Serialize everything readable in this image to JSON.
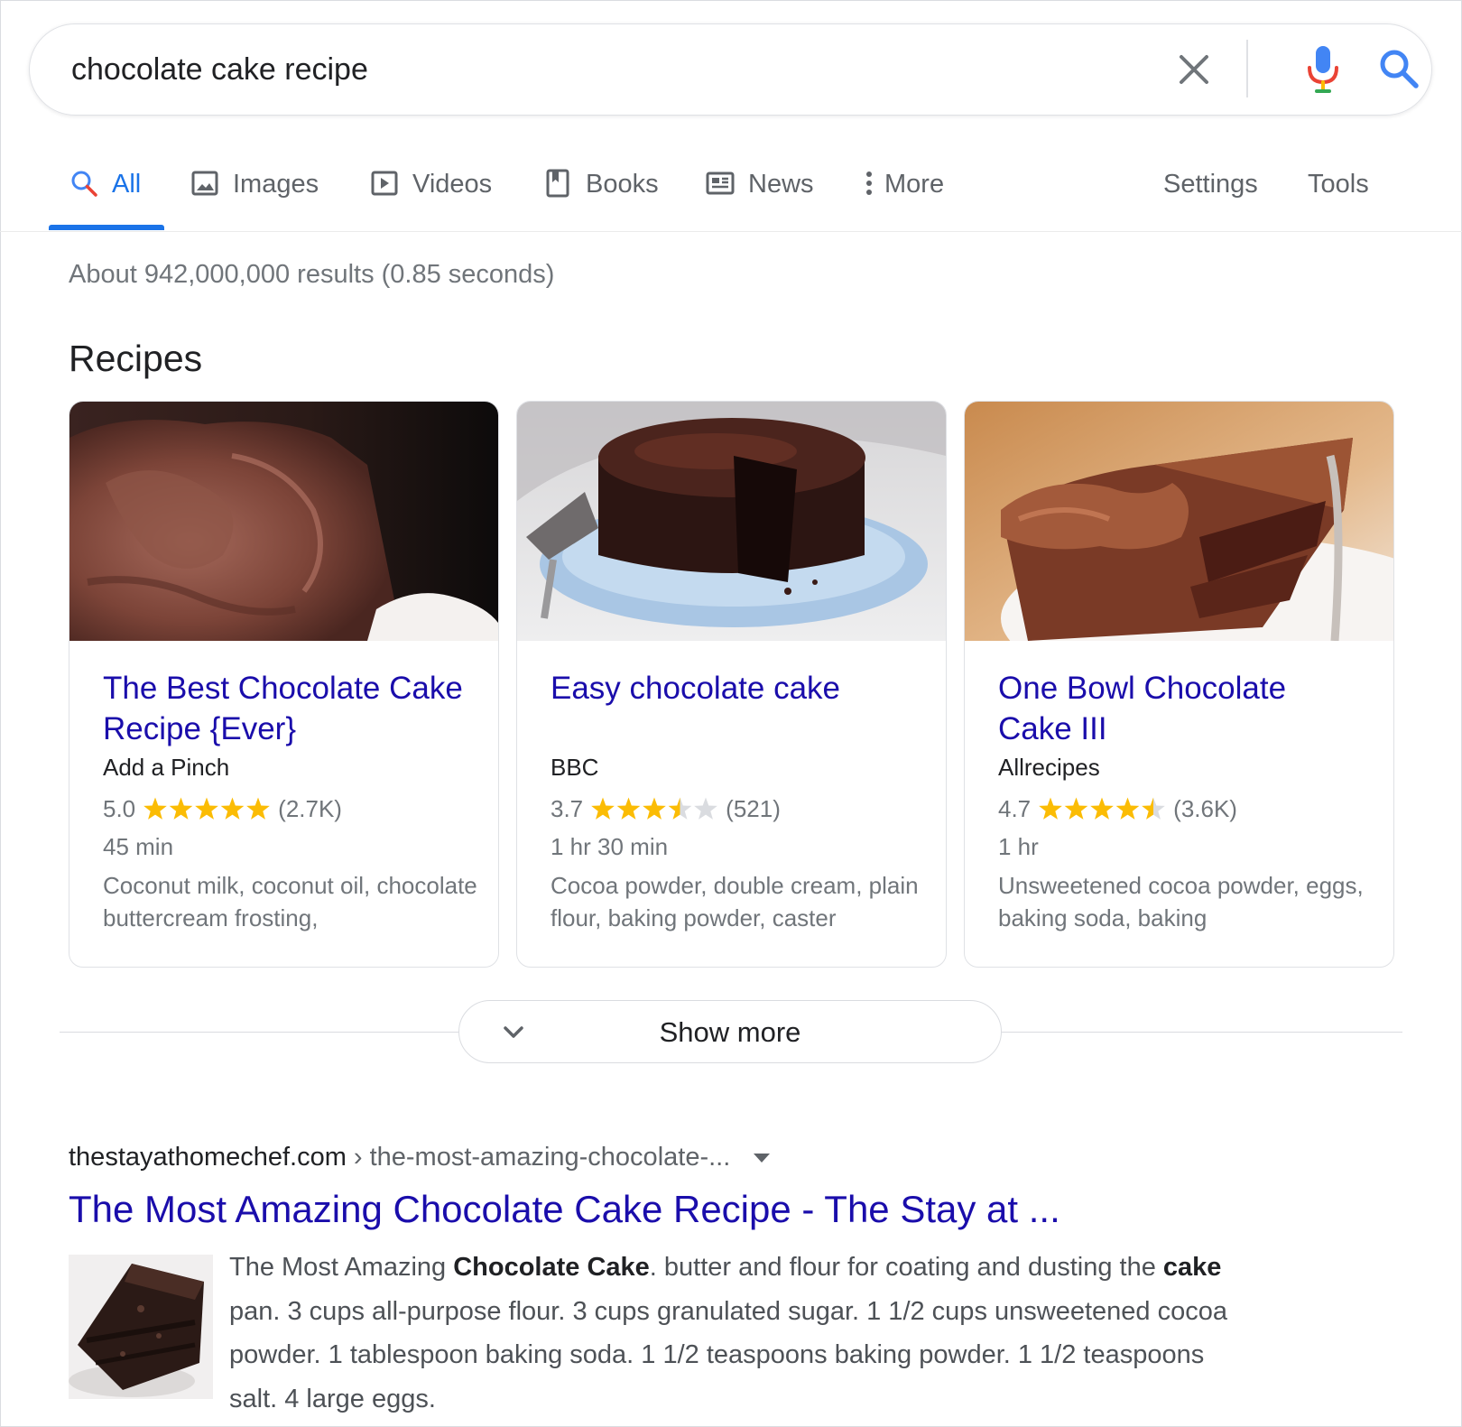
{
  "search": {
    "query": "chocolate cake recipe"
  },
  "tabs": [
    {
      "label": "All",
      "icon": "search-icon",
      "active": true
    },
    {
      "label": "Images",
      "icon": "image-icon"
    },
    {
      "label": "Videos",
      "icon": "play-icon"
    },
    {
      "label": "Books",
      "icon": "book-icon"
    },
    {
      "label": "News",
      "icon": "newspaper-icon"
    },
    {
      "label": "More",
      "icon": "more-vert-icon"
    },
    {
      "label": "Settings"
    },
    {
      "label": "Tools"
    }
  ],
  "stats": "About 942,000,000 results (0.85 seconds)",
  "recipes": {
    "heading": "Recipes",
    "cards": [
      {
        "title": "The Best Chocolate Cake Recipe {Ever}",
        "source": "Add a Pinch",
        "rating": "5.0",
        "stars": 5.0,
        "reviews": "(2.7K)",
        "time": "45 min",
        "ingredients": "Coconut milk, coconut oil, chocolate buttercream frosting,"
      },
      {
        "title": "Easy chocolate cake",
        "source": "BBC",
        "rating": "3.7",
        "stars": 3.5,
        "reviews": "(521)",
        "time": "1 hr 30 min",
        "ingredients": "Cocoa powder, double cream, plain flour, baking powder, caster"
      },
      {
        "title": "One Bowl Chocolate Cake III",
        "source": "Allrecipes",
        "rating": "4.7",
        "stars": 4.5,
        "reviews": "(3.6K)",
        "time": "1 hr",
        "ingredients": "Unsweetened cocoa powder, eggs, baking soda, baking"
      }
    ],
    "show_more": "Show more"
  },
  "result": {
    "domain": "thestayathomechef.com",
    "separator": "›",
    "path": "the-most-amazing-chocolate-...",
    "title": "The Most Amazing Chocolate Cake Recipe - The Stay at ...",
    "snippet": [
      {
        "text": "The Most Amazing "
      },
      {
        "text": "Chocolate Cake",
        "bold": true
      },
      {
        "text": ". butter and flour for coating and dusting the "
      },
      {
        "text": "cake",
        "bold": true
      },
      {
        "text": " pan. 3 cups all-purpose flour. 3 cups granulated sugar. 1 1/2 cups unsweetened cocoa powder. 1 tablespoon baking soda. 1 1/2 teaspoons baking powder. 1 1/2 teaspoons salt. 4 large eggs."
      }
    ]
  },
  "colors": {
    "link": "#1a0dab",
    "accent": "#1a73e8",
    "star": "#fbbc04",
    "muted": "#70757a"
  }
}
